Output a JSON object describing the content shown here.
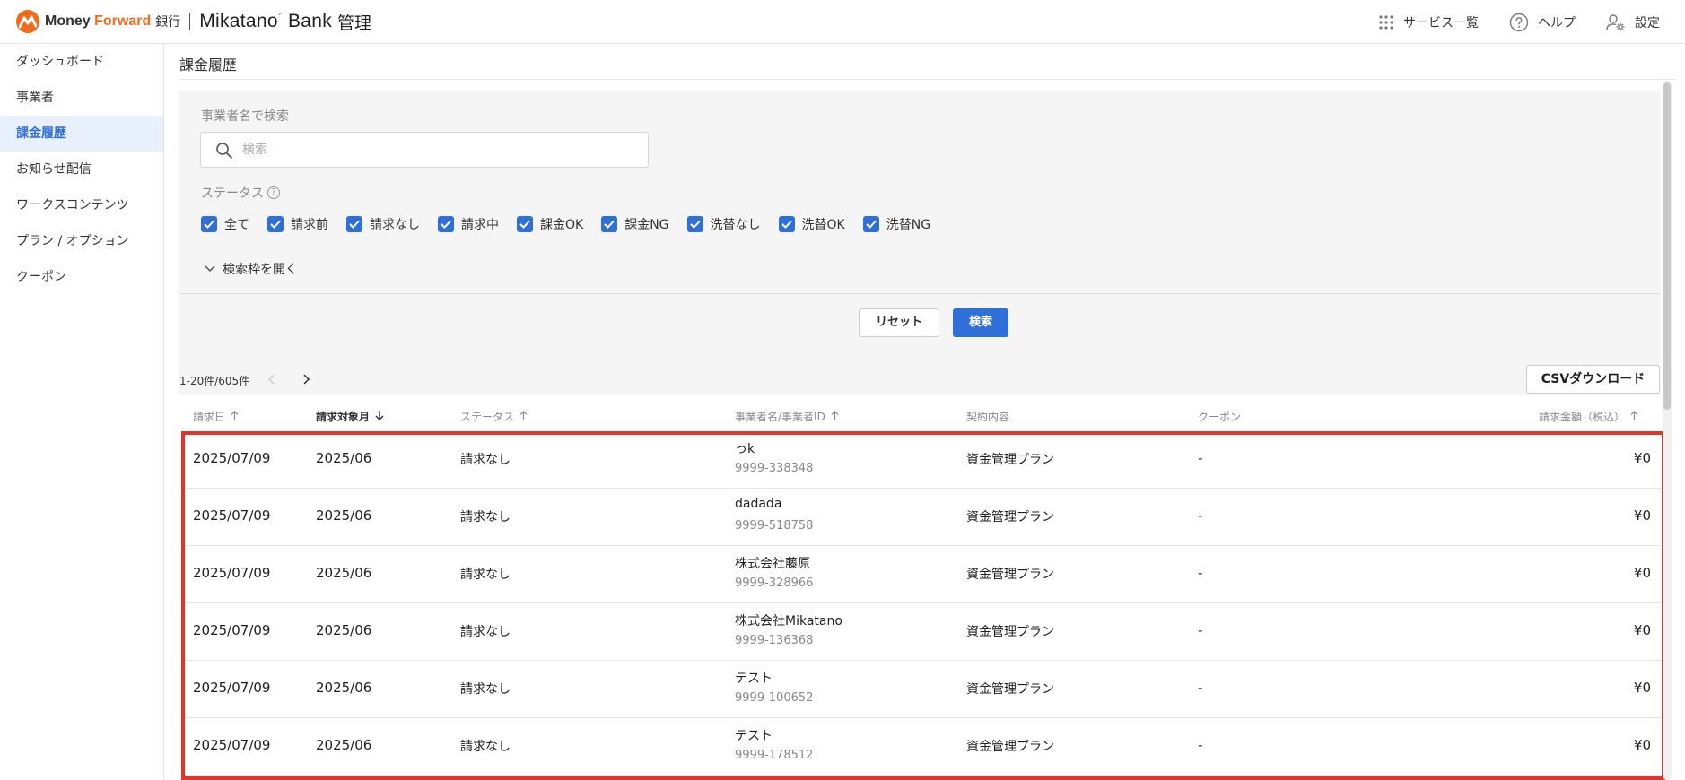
{
  "header": {
    "brand_money": "Money ",
    "brand_forward": "Forward",
    "brand_bank": "銀行",
    "app_name_main": "Mikatano",
    "app_name_accent": "´",
    "app_name_bank": " Bank",
    "app_admin": "管理",
    "nav": [
      {
        "label": "サービス一覧",
        "icon": "grid-icon"
      },
      {
        "label": "ヘルプ",
        "icon": "help-icon"
      },
      {
        "label": "設定",
        "icon": "user-settings-icon"
      }
    ]
  },
  "sidebar": {
    "items": [
      {
        "label": "ダッシュボード",
        "active": false
      },
      {
        "label": "事業者",
        "active": false
      },
      {
        "label": "課金履歴",
        "active": true
      },
      {
        "label": "お知らせ配信",
        "active": false
      },
      {
        "label": "ワークスコンテンツ",
        "active": false
      },
      {
        "label": "プラン / オプション",
        "active": false
      },
      {
        "label": "クーポン",
        "active": false
      }
    ]
  },
  "page": {
    "title": "課金履歴"
  },
  "search": {
    "label": "事業者名で検索",
    "placeholder": "検索",
    "value": "",
    "status_label": "ステータス",
    "help_glyph": "?",
    "statuses": [
      {
        "label": "全て",
        "checked": true
      },
      {
        "label": "請求前",
        "checked": true
      },
      {
        "label": "請求なし",
        "checked": true
      },
      {
        "label": "請求中",
        "checked": true
      },
      {
        "label": "課金OK",
        "checked": true
      },
      {
        "label": "課金NG",
        "checked": true
      },
      {
        "label": "洗替なし",
        "checked": true
      },
      {
        "label": "洗替OK",
        "checked": true
      },
      {
        "label": "洗替NG",
        "checked": true
      }
    ],
    "expand_label": "検索枠を開く",
    "reset_label": "リセット",
    "search_label": "検索"
  },
  "pagination": {
    "range": "1-20件/605件"
  },
  "csv_label": "CSVダウンロード",
  "table": {
    "columns": [
      {
        "label": "請求日",
        "sort": "asc"
      },
      {
        "label": "請求対象月",
        "sort": "desc"
      },
      {
        "label": "ステータス",
        "sort": "asc"
      },
      {
        "label": "事業者名/事業者ID",
        "sort": "asc"
      },
      {
        "label": "契約内容",
        "sort": ""
      },
      {
        "label": "クーポン",
        "sort": ""
      },
      {
        "label": "請求金額（税込）",
        "sort": "asc"
      }
    ],
    "rows": [
      {
        "date": "2025/07/09",
        "month": "2025/06",
        "status": "請求なし",
        "name": "っk",
        "id": "9999-338348",
        "plan": "資金管理プラン",
        "coupon": "-",
        "amount": "¥0"
      },
      {
        "date": "2025/07/09",
        "month": "2025/06",
        "status": "請求なし",
        "name": "dadada",
        "id": "9999-518758",
        "plan": "資金管理プラン",
        "coupon": "-",
        "amount": "¥0"
      },
      {
        "date": "2025/07/09",
        "month": "2025/06",
        "status": "請求なし",
        "name": "株式会社藤原",
        "id": "9999-328966",
        "plan": "資金管理プラン",
        "coupon": "-",
        "amount": "¥0"
      },
      {
        "date": "2025/07/09",
        "month": "2025/06",
        "status": "請求なし",
        "name": "株式会社Mikatano",
        "id": "9999-136368",
        "plan": "資金管理プラン",
        "coupon": "-",
        "amount": "¥0"
      },
      {
        "date": "2025/07/09",
        "month": "2025/06",
        "status": "請求なし",
        "name": "テスト",
        "id": "9999-100652",
        "plan": "資金管理プラン",
        "coupon": "-",
        "amount": "¥0"
      },
      {
        "date": "2025/07/09",
        "month": "2025/06",
        "status": "請求なし",
        "name": "テスト",
        "id": "9999-178512",
        "plan": "資金管理プラン",
        "coupon": "-",
        "amount": "¥0"
      }
    ]
  },
  "colors": {
    "accent": "#2e6fd8",
    "brand_orange": "#f26b1d",
    "highlight": "#e1352b"
  }
}
